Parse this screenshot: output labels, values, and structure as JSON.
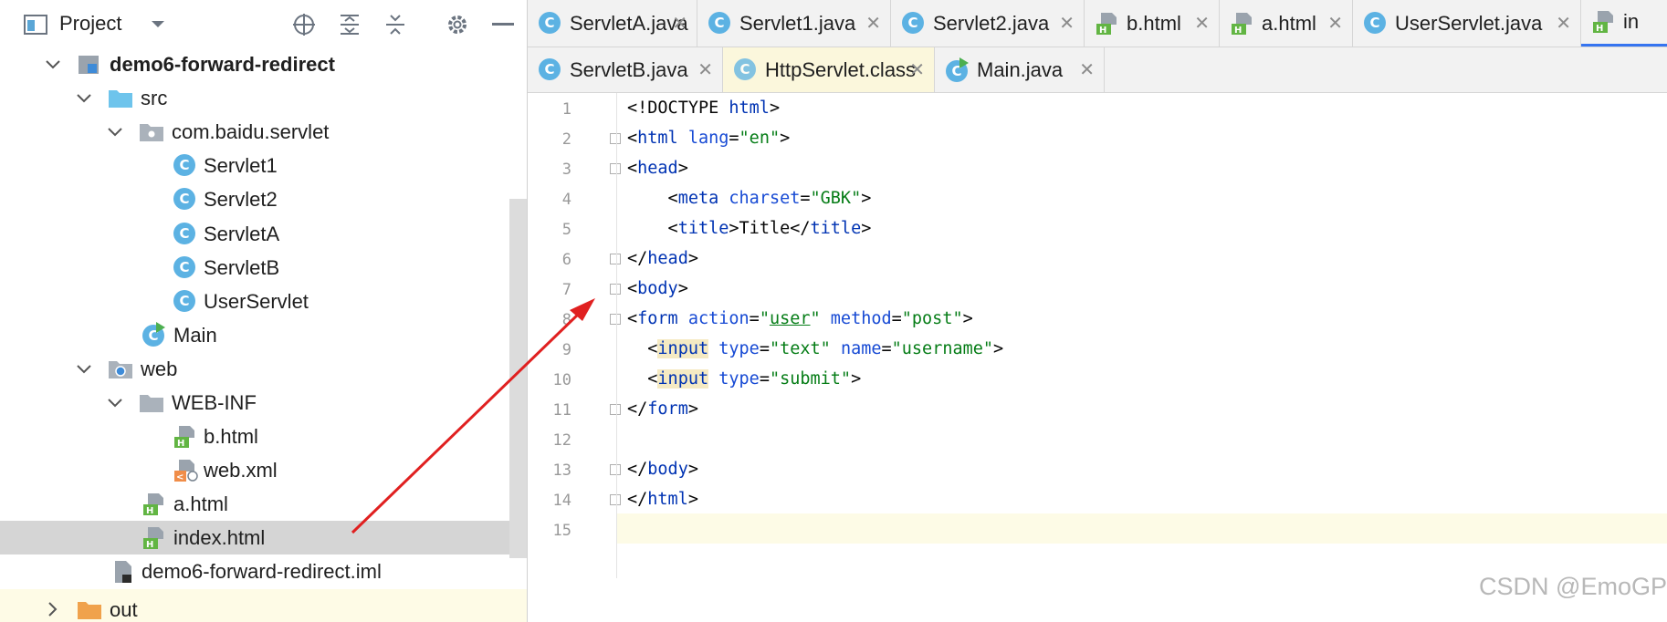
{
  "project_panel": {
    "title": "Project",
    "tree": [
      {
        "label": "demo6-forward-redirect",
        "kind": "module",
        "bold": true
      },
      {
        "label": "src",
        "kind": "folder-src"
      },
      {
        "label": "com.baidu.servlet",
        "kind": "package"
      },
      {
        "label": "Servlet1",
        "kind": "class"
      },
      {
        "label": "Servlet2",
        "kind": "class"
      },
      {
        "label": "ServletA",
        "kind": "class"
      },
      {
        "label": "ServletB",
        "kind": "class"
      },
      {
        "label": "UserServlet",
        "kind": "class"
      },
      {
        "label": "Main",
        "kind": "class-main"
      },
      {
        "label": "web",
        "kind": "folder-web"
      },
      {
        "label": "WEB-INF",
        "kind": "folder"
      },
      {
        "label": "b.html",
        "kind": "html"
      },
      {
        "label": "web.xml",
        "kind": "xml"
      },
      {
        "label": "a.html",
        "kind": "html"
      },
      {
        "label": "index.html",
        "kind": "html",
        "selected": true
      },
      {
        "label": "demo6-forward-redirect.iml",
        "kind": "iml"
      },
      {
        "label": "out",
        "kind": "folder-out"
      }
    ]
  },
  "tabs_row_1": [
    {
      "label": "ServletA.java",
      "icon": "class-icon"
    },
    {
      "label": "Servlet1.java",
      "icon": "class-icon"
    },
    {
      "label": "Servlet2.java",
      "icon": "class-icon"
    },
    {
      "label": "b.html",
      "icon": "html-file-icon"
    },
    {
      "label": "a.html",
      "icon": "html-file-icon"
    },
    {
      "label": "UserServlet.java",
      "icon": "class-icon"
    },
    {
      "label": "in",
      "icon": "html-file-icon"
    }
  ],
  "tabs_row_2": [
    {
      "label": "ServletB.java",
      "icon": "class-icon"
    },
    {
      "label": "HttpServlet.class",
      "icon": "class-icon"
    },
    {
      "label": "Main.java",
      "icon": "class-main-icon"
    }
  ],
  "close_glyph": "✕",
  "editor": {
    "line_numbers": [
      "1",
      "2",
      "3",
      "4",
      "5",
      "6",
      "7",
      "8",
      "9",
      "10",
      "11",
      "12",
      "13",
      "14",
      "15"
    ],
    "lines": [
      "<!DOCTYPE html>",
      "<html lang=\"en\">",
      "<head>",
      "    <meta charset=\"GBK\">",
      "    <title>Title</title>",
      "</head>",
      "<body>",
      "<form action=\"user\" method=\"post\">",
      "  <input type=\"text\" name=\"username\">",
      "  <input type=\"submit\">",
      "</form>",
      "",
      "</body>",
      "</html>",
      ""
    ]
  },
  "watermark": "CSDN @EmoGP",
  "colors": {
    "tag": "#0033b3",
    "attribute": "#174ad4",
    "string": "#067d17",
    "annotation_arrow": "#e02020",
    "selected_row": "#d5d5d5"
  }
}
